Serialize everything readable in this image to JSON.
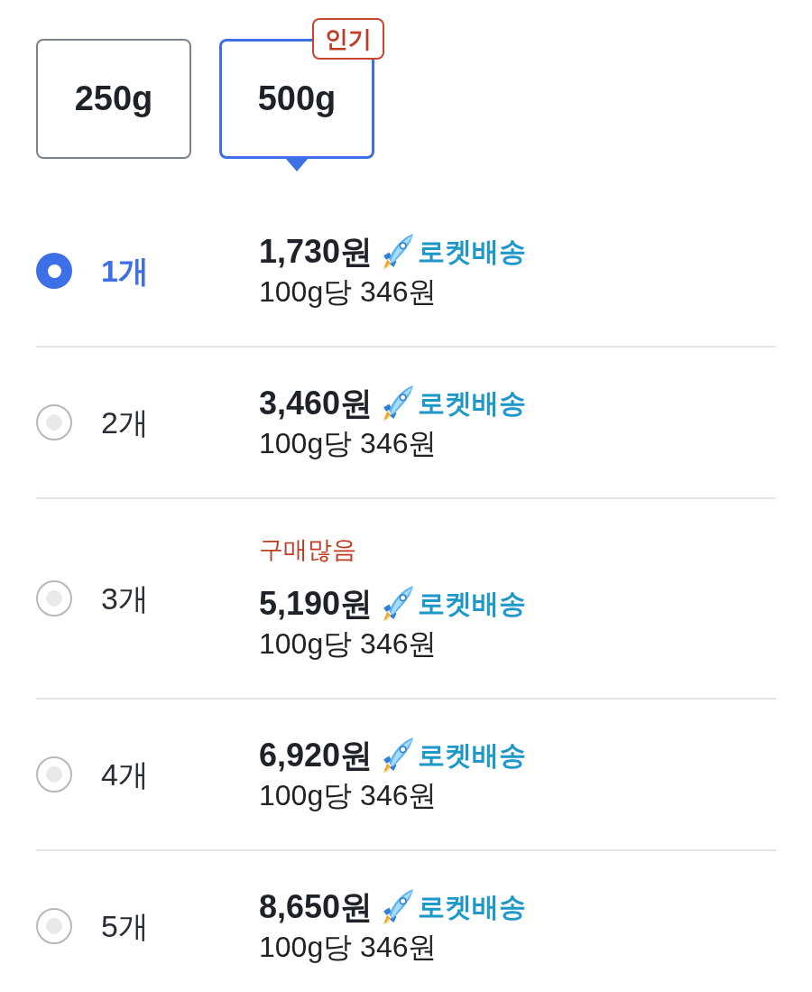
{
  "weights": [
    {
      "label": "250g",
      "selected": false
    },
    {
      "label": "500g",
      "selected": true,
      "badge": "인기"
    }
  ],
  "options": [
    {
      "quantity": "1개",
      "selected": true,
      "price": "1,730원",
      "delivery": "로켓배송",
      "unit_price": "100g당 346원"
    },
    {
      "quantity": "2개",
      "selected": false,
      "price": "3,460원",
      "delivery": "로켓배송",
      "unit_price": "100g당 346원"
    },
    {
      "quantity": "3개",
      "selected": false,
      "tag": "구매많음",
      "price": "5,190원",
      "delivery": "로켓배송",
      "unit_price": "100g당 346원"
    },
    {
      "quantity": "4개",
      "selected": false,
      "price": "6,920원",
      "delivery": "로켓배송",
      "unit_price": "100g당 346원"
    },
    {
      "quantity": "5개",
      "selected": false,
      "price": "8,650원",
      "delivery": "로켓배송",
      "unit_price": "100g당 346원"
    }
  ]
}
